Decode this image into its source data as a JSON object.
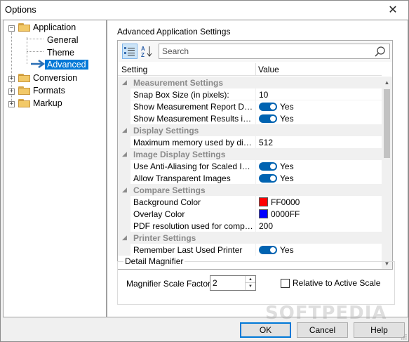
{
  "window": {
    "title": "Options"
  },
  "tree": {
    "items": [
      {
        "label": "Application"
      },
      {
        "label": "General"
      },
      {
        "label": "Theme"
      },
      {
        "label": "Advanced"
      },
      {
        "label": "Conversion"
      },
      {
        "label": "Formats"
      },
      {
        "label": "Markup"
      }
    ]
  },
  "panel": {
    "title": "Advanced Application Settings",
    "search": {
      "placeholder": "Search",
      "value": ""
    },
    "columns": {
      "setting": "Setting",
      "value": "Value"
    },
    "categories": {
      "measurement": "Measurement Settings",
      "display": "Display Settings",
      "image": "Image Display Settings",
      "compare": "Compare Settings",
      "printer": "Printer Settings"
    },
    "rows": {
      "snap_box": {
        "name": "Snap Box Size (in pixels):",
        "value": "10"
      },
      "show_report": {
        "name": "Show Measurement Report Dialog",
        "value": "Yes"
      },
      "show_results": {
        "name": "Show Measurement Results in a T...",
        "value": "Yes"
      },
      "max_memory": {
        "name": "Maximum memory used by display ...",
        "value": "512"
      },
      "anti_alias": {
        "name": "Use Anti-Aliasing for Scaled Images",
        "value": "Yes"
      },
      "transparent": {
        "name": "Allow Transparent Images",
        "value": "Yes"
      },
      "bg_color": {
        "name": "Background Color",
        "value": "FF0000",
        "color": "#ff0000"
      },
      "overlay_color": {
        "name": "Overlay Color",
        "value": "0000FF",
        "color": "#0000ff"
      },
      "pdf_res": {
        "name": "PDF resolution used for compare",
        "value": "200"
      },
      "remember_printer": {
        "name": "Remember Last Used Printer",
        "value": "Yes"
      }
    },
    "magnifier": {
      "legend": "Detail Magnifier",
      "scale_label": "Magnifier Scale Factor:",
      "scale_value": "2",
      "relative_label": "Relative to Active Scale",
      "relative_checked": false
    }
  },
  "buttons": {
    "ok": "OK",
    "cancel": "Cancel",
    "help": "Help"
  },
  "watermark": "SOFTPEDIA",
  "colors": {
    "accent": "#0078d7",
    "toggle": "#0063b1"
  }
}
